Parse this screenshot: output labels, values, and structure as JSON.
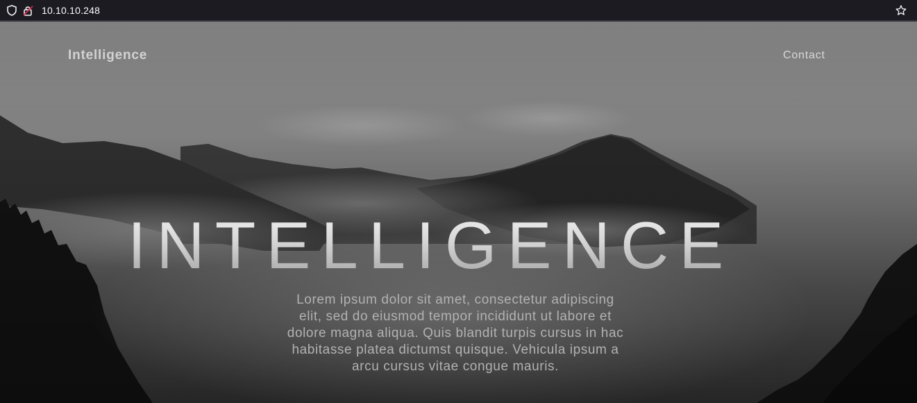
{
  "browser": {
    "url": "10.10.10.248",
    "icons": [
      "shield-icon",
      "insecure-lock-icon",
      "bookmark-star-icon"
    ]
  },
  "nav": {
    "brand": "Intelligence",
    "contact": "Contact"
  },
  "hero": {
    "title": "INTELLIGENCE",
    "text": "Lorem ipsum dolor sit amet, consectetur adipiscing elit, sed do eiusmod tempor incididunt ut labore et dolore magna aliqua. Quis blandit turpis cursus in hac habitasse platea dictumst quisque. Vehicula ipsum a arcu cursus vitae congue mauris."
  },
  "colors": {
    "browser_bar": "#1c1b22",
    "url_text": "#fbfbfe",
    "nav_text": "#d2d2d2",
    "hero_text": "#b2b2b2"
  }
}
